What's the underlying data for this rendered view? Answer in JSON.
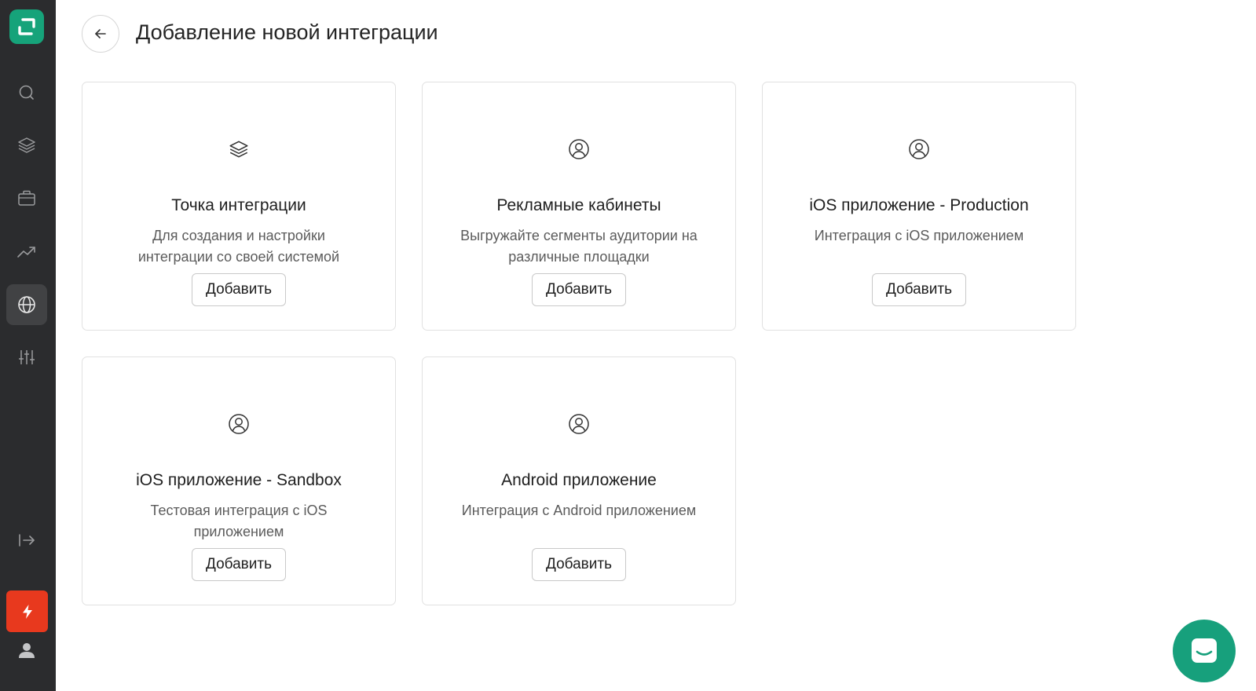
{
  "page": {
    "title": "Добавление новой интеграции"
  },
  "sidebar": {
    "items": [
      {
        "icon": "search-icon"
      },
      {
        "icon": "layers-icon"
      },
      {
        "icon": "briefcase-icon"
      },
      {
        "icon": "trending-up-icon"
      },
      {
        "icon": "globe-icon",
        "active": true
      },
      {
        "icon": "sliders-icon"
      }
    ],
    "bottom": [
      {
        "icon": "logout-icon"
      },
      {
        "icon": "bolt-icon"
      },
      {
        "icon": "user-icon"
      }
    ]
  },
  "cards": [
    {
      "icon": "layers-icon",
      "title": "Точка интеграции",
      "description": "Для создания и настройки интеграции со своей системой",
      "button": "Добавить"
    },
    {
      "icon": "user-circle-icon",
      "title": "Рекламные кабинеты",
      "description": "Выгружайте сегменты аудитории на различные площадки",
      "button": "Добавить"
    },
    {
      "icon": "user-circle-icon",
      "title": "iOS приложение - Production",
      "description": "Интеграция с iOS приложением",
      "button": "Добавить"
    },
    {
      "icon": "user-circle-icon",
      "title": "iOS приложение - Sandbox",
      "description": "Тестовая интеграция с iOS приложением",
      "button": "Добавить"
    },
    {
      "icon": "user-circle-icon",
      "title": "Android приложение",
      "description": "Интеграция с Android приложением",
      "button": "Добавить"
    }
  ],
  "colors": {
    "sidebar": "#2b2c2e",
    "brand": "#16a37a",
    "alert": "#e8391e"
  }
}
